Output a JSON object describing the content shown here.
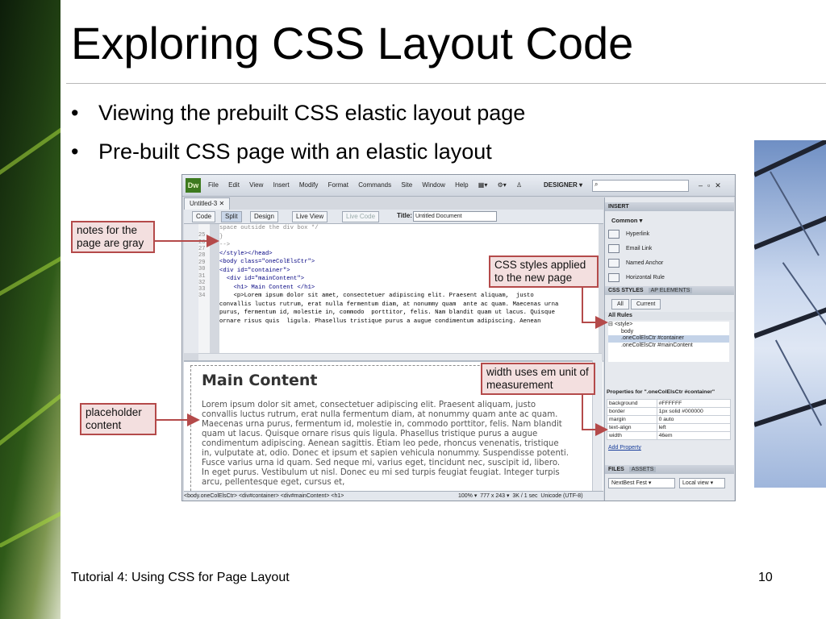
{
  "slide": {
    "title": "Exploring CSS Layout Code",
    "bullets": [
      "Viewing the prebuilt CSS elastic layout page",
      "Pre-built CSS page with an elastic layout"
    ],
    "footer_text": "Tutorial 4: Using CSS for Page Layout",
    "page_number": "10",
    "accent_color": "#b44a4a",
    "callout_fill": "#f3dfdf"
  },
  "app": {
    "logo": "Dw",
    "menus": [
      "File",
      "Edit",
      "View",
      "Insert",
      "Modify",
      "Format",
      "Commands",
      "Site",
      "Window",
      "Help"
    ],
    "workspace": "DESIGNER",
    "doc_tab": "Untitled-3",
    "view_buttons": {
      "code": "Code",
      "split": "Split",
      "design": "Design",
      "live_view": "Live View",
      "live_code": "Live Code"
    },
    "title_label": "Title:",
    "title_value": "Untitled Document"
  },
  "code": {
    "line_numbers": [
      "25",
      "26",
      "27",
      "28",
      "29",
      "30",
      "31",
      "32",
      "33",
      "34"
    ],
    "lines": [
      "space outside the div box */",
      "}",
      "-->",
      "</style></head>",
      "",
      "<body class=\"oneColElsCtr\">",
      "",
      "<div id=\"container\">",
      "  <div id=\"mainContent\">",
      "    <h1> Main Content </h1>",
      "    <p>Lorem ipsum dolor sit amet, consectetuer adipiscing elit. Praesent aliquam,  justo",
      "convallis luctus rutrum, erat nulla fermentum diam, at nonummy quam  ante ac quam. Maecenas urna",
      "purus, fermentum id, molestie in, commodo  porttitor, felis. Nam blandit quam ut lacus. Quisque",
      "ornare risus quis  ligula. Phasellus tristique purus a augue condimentum adipiscing. Aenean"
    ]
  },
  "design_view": {
    "heading": "Main Content",
    "paragraph": "Lorem ipsum dolor sit amet, consectetuer adipiscing elit. Praesent aliquam, justo convallis luctus rutrum, erat nulla fermentum diam, at nonummy quam ante ac quam. Maecenas urna purus, fermentum id, molestie in, commodo porttitor, felis. Nam blandit quam ut lacus. Quisque ornare risus quis ligula. Phasellus tristique purus a augue condimentum adipiscing. Aenean sagittis. Etiam leo pede, rhoncus venenatis, tristique in, vulputate at, odio. Donec et ipsum et sapien vehicula nonummy. Suspendisse potenti. Fusce varius urna id quam. Sed neque mi, varius eget, tincidunt nec, suscipit id, libero. In eget purus. Vestibulum ut nisl. Donec eu mi sed turpis feugiat feugiat. Integer turpis arcu, pellentesque eget, cursus et,"
  },
  "status_bar": {
    "path": "<body.oneColElsCtr> <div#container> <div#mainContent> <h1>",
    "zoom": "100%",
    "size": "777 x 243",
    "download": "3K / 1 sec",
    "encoding": "Unicode (UTF-8)"
  },
  "panels": {
    "insert_header": "INSERT",
    "insert_category": "Common",
    "insert_items": [
      "Hyperlink",
      "Email Link",
      "Named Anchor",
      "Horizontal Rule"
    ],
    "css_tab": "CSS STYLES",
    "ap_tab": "AP ELEMENTS",
    "btn_all": "All",
    "btn_current": "Current",
    "all_rules": "All Rules",
    "rules": [
      "<style>",
      "body",
      ".oneColElsCtr #container",
      ".oneColElsCtr #mainContent"
    ],
    "properties_label": "Properties for \".oneColElsCtr #container\"",
    "properties": [
      {
        "name": "background",
        "value": "#FFFFFF"
      },
      {
        "name": "border",
        "value": "1px solid #000000"
      },
      {
        "name": "margin",
        "value": "0 auto"
      },
      {
        "name": "text-align",
        "value": "left"
      },
      {
        "name": "width",
        "value": "46em"
      }
    ],
    "add_property": "Add Property",
    "files_tab": "FILES",
    "assets_tab": "ASSETS",
    "site_name": "NextBest Fest",
    "site_view": "Local view"
  },
  "callouts": {
    "notes_gray": "notes for the page are gray",
    "css_applied": "CSS styles applied to the new page",
    "width_em": "width uses em unit of measurement",
    "placeholder": "placeholder content"
  }
}
